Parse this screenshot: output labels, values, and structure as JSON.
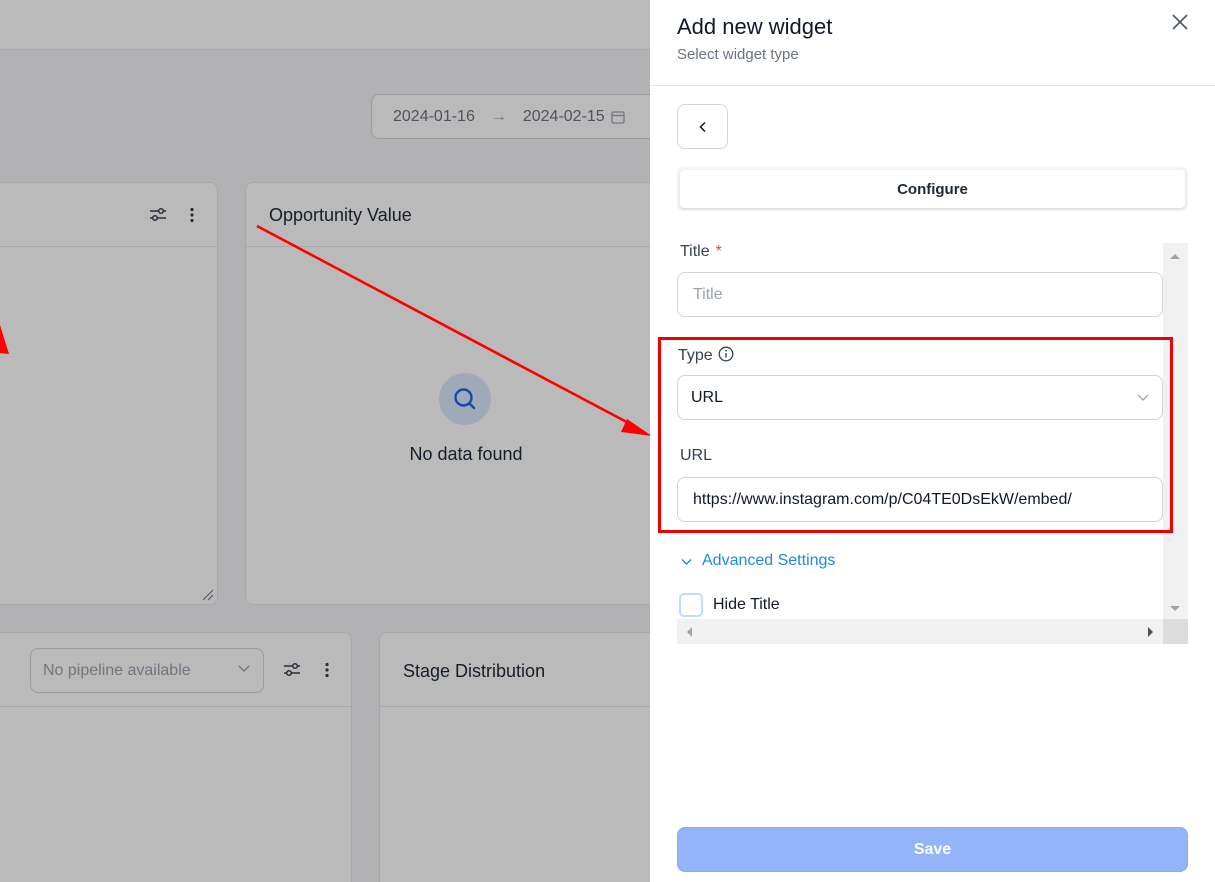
{
  "dashboard": {
    "date_start": "2024-01-16",
    "date_end": "2024-02-15",
    "widgets": {
      "opportunity_value": {
        "title": "Opportunity Value",
        "empty_text": "No data found"
      },
      "pipeline_select": {
        "placeholder": "No pipeline available"
      },
      "stage_distribution": {
        "title": "Stage Distribution"
      }
    }
  },
  "drawer": {
    "title": "Add new widget",
    "subtitle": "Select widget type",
    "tab_label": "Configure",
    "form": {
      "title_label": "Title",
      "title_required_mark": "*",
      "title_placeholder": "Title",
      "type_label": "Type",
      "type_value": "URL",
      "url_label": "URL",
      "url_value": "https://www.instagram.com/p/C04TE0DsEkW/embed/",
      "advanced_settings_label": "Advanced Settings",
      "hide_title_label": "Hide Title"
    },
    "save_label": "Save"
  },
  "colors": {
    "accent_blue": "#1e88e5",
    "save_button": "#93b4f9",
    "annotation_red": "#ef0000",
    "required_red": "#ef4444"
  }
}
